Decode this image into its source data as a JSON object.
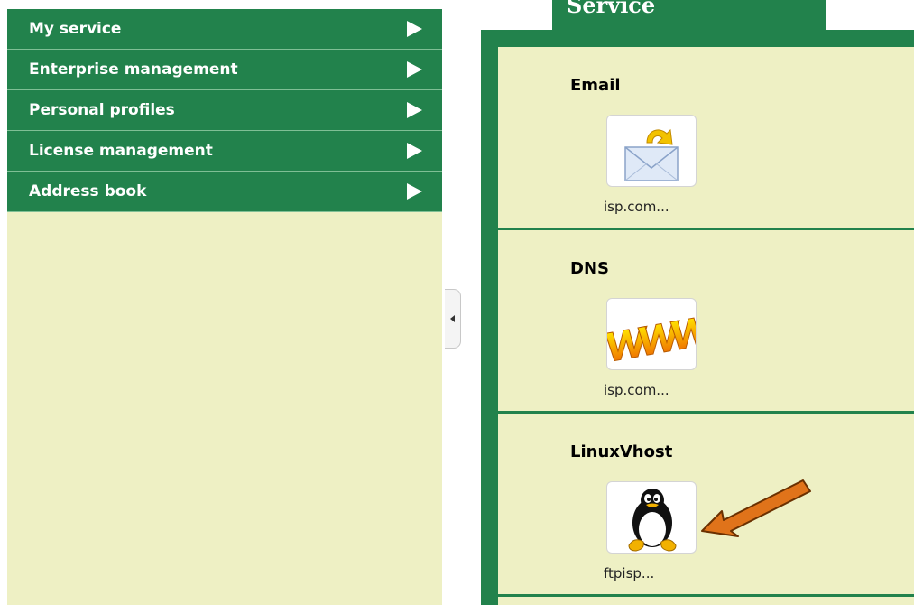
{
  "sidebar": {
    "items": [
      {
        "label": "My service"
      },
      {
        "label": "Enterprise management"
      },
      {
        "label": "Personal profiles"
      },
      {
        "label": "License management"
      },
      {
        "label": "Address book"
      }
    ]
  },
  "service_panel": {
    "tab_label": "Service",
    "sections": [
      {
        "title": "Email",
        "icon": "email-envelope-icon",
        "caption": "isp.com..."
      },
      {
        "title": "DNS",
        "icon": "www-icon",
        "caption": "isp.com..."
      },
      {
        "title": "LinuxVhost",
        "icon": "linux-penguin-icon",
        "caption": "ftpisp..."
      }
    ]
  },
  "annotation": {
    "icon": "orange-pointer-arrow"
  },
  "colors": {
    "menu_green": "#22824c",
    "panel_bg": "#eef0c4",
    "arrow_orange": "#e0731a"
  }
}
